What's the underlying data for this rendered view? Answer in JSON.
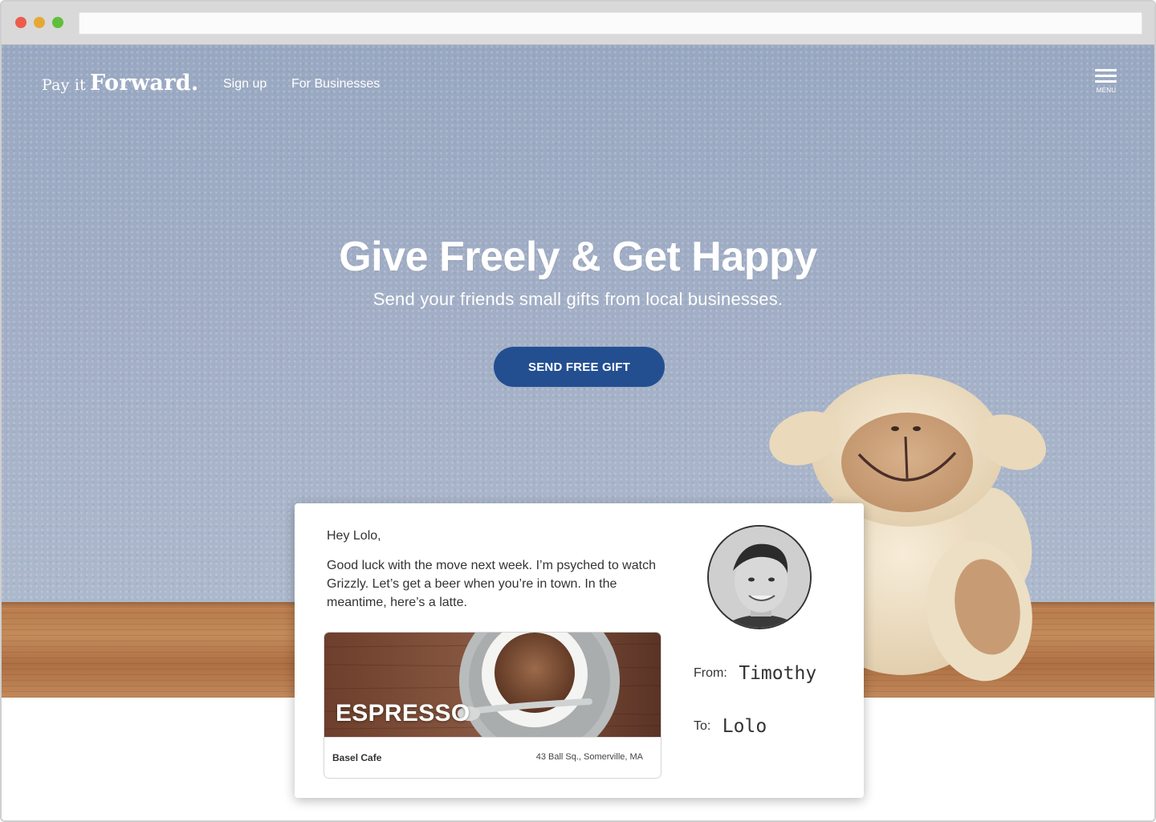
{
  "logo": {
    "small": "Pay it",
    "big": "Forward."
  },
  "nav": {
    "signup": "Sign up",
    "business": "For Businesses",
    "menu_label": "MENU"
  },
  "hero": {
    "headline": "Give Freely & Get Happy",
    "subhead": "Send your friends small gifts from local businesses.",
    "cta": "SEND FREE GIFT"
  },
  "card": {
    "greeting": "Hey Lolo,",
    "message": "Good luck with the move next week. I’m psyched to watch Grizzly. Let’s get a beer when you’re in town. In the meantime, here’s a latte.",
    "from_label": "From:",
    "from_value": "Timothy",
    "to_label": "To:",
    "to_value": "Lolo",
    "voucher": {
      "title": "ESPRESSO",
      "cafe_name": "Basel Cafe",
      "cafe_address": "43 Ball Sq., Somerville, MA"
    }
  },
  "colors": {
    "cta_background": "#234f91",
    "hero_wall": "#a0adc5",
    "shelf_wood": "#b97d4e"
  },
  "icons": {
    "menu": "hamburger-menu-icon",
    "window_controls": [
      "close-dot",
      "minimize-dot",
      "maximize-dot"
    ]
  }
}
